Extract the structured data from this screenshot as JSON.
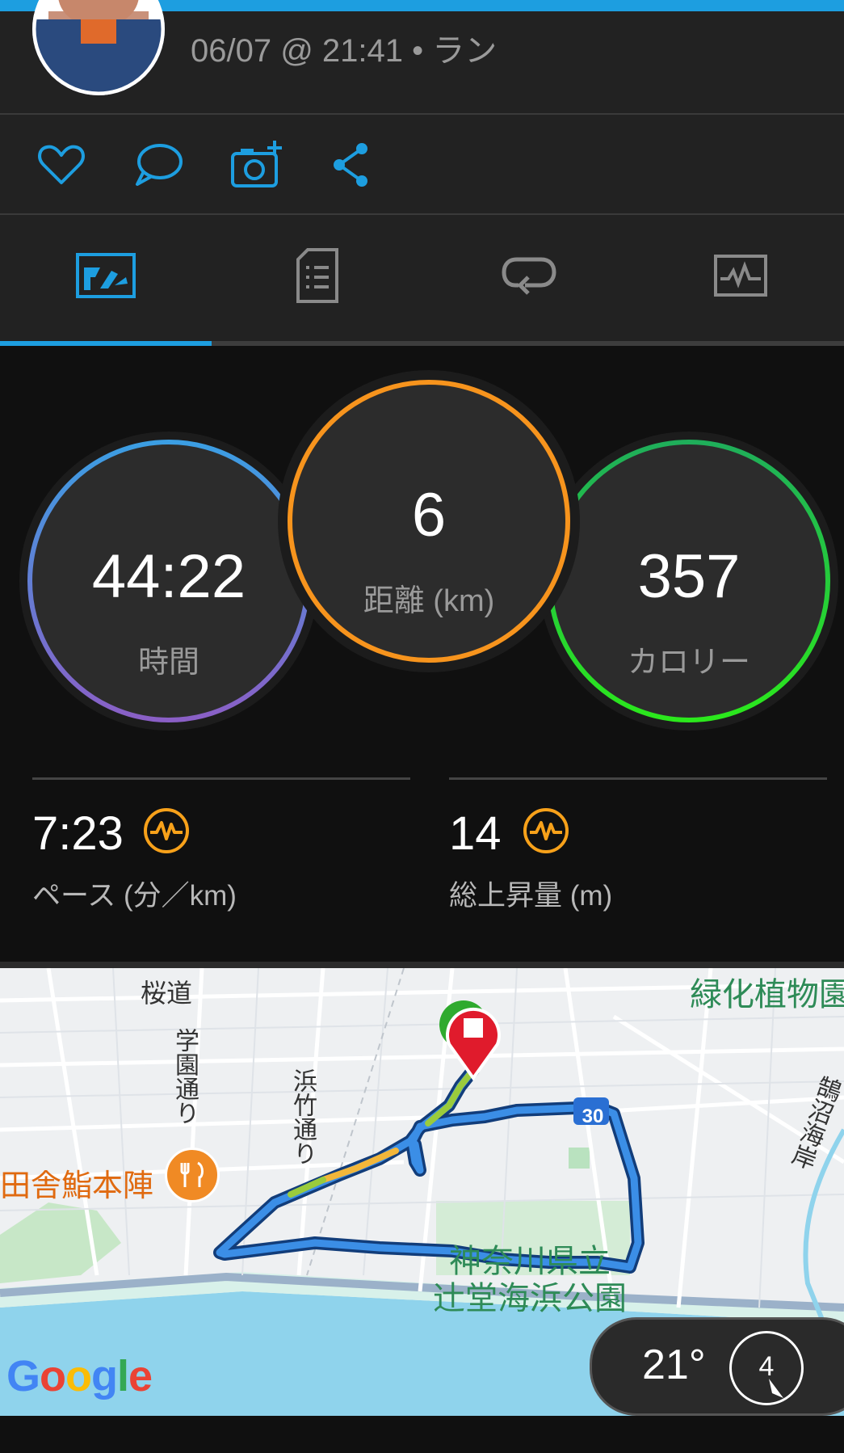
{
  "header": {
    "subtitle": "06/07 @ 21:41 • ラン"
  },
  "actions": [
    "heart-icon",
    "comment-icon",
    "add-photo-icon",
    "share-icon"
  ],
  "tabs": [
    "overview-tab",
    "details-tab",
    "laps-tab",
    "charts-tab"
  ],
  "rings": {
    "time": {
      "value": "44:22",
      "label": "時間"
    },
    "distance": {
      "value": "6",
      "label": "距離 (km)"
    },
    "calories": {
      "value": "357",
      "label": "カロリー"
    }
  },
  "stats": {
    "pace": {
      "value": "7:23",
      "label": "ペース (分／km)"
    },
    "elevation": {
      "value": "14",
      "label": "総上昇量 (m)"
    }
  },
  "map": {
    "labels": {
      "sakuramichi": "桜道",
      "gakuen": "学園通り",
      "hamatake": "浜竹通り",
      "restaurant": "田舎鮨本陣",
      "park_line1": "神奈川県立",
      "park_line2": "辻堂海浜公園",
      "garden": "緑化植物園",
      "kugenuma": "鵠沼海岸",
      "route_number": "30"
    },
    "google": "Google"
  },
  "weather": {
    "temp": "21°",
    "wind": "4"
  },
  "colors": {
    "accent": "#1d9ee0",
    "time_ring": "#4a86d6",
    "distance_ring": "#f7941d",
    "calorie_ring": "#2fd13c",
    "pace_icon": "#f7a11a"
  }
}
